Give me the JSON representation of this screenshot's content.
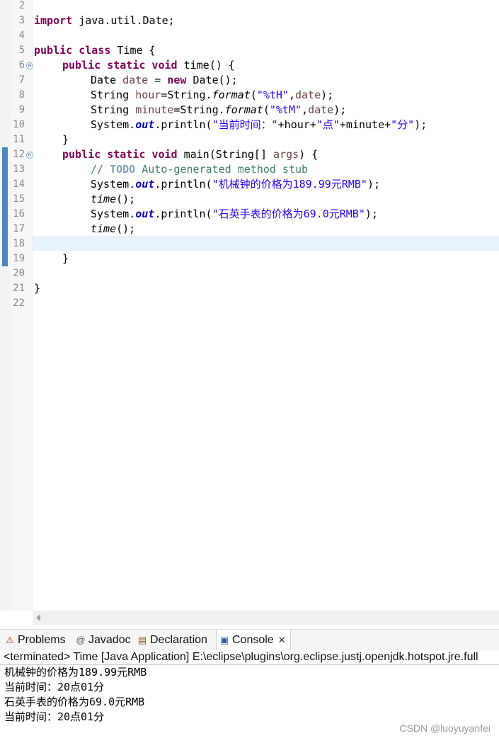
{
  "editor": {
    "line_numbers": [
      "2",
      "3",
      "4",
      "5",
      "6",
      "7",
      "8",
      "9",
      "10",
      "11",
      "12",
      "13",
      "14",
      "15",
      "16",
      "17",
      "18",
      "19",
      "20",
      "21",
      "22"
    ],
    "lines": {
      "l3": {
        "kw": "import",
        "rest": " java.util.Date;"
      },
      "l5": {
        "kw": "public class",
        "rest": " Time {"
      },
      "l6": {
        "kw": "public static void",
        "rest": " time() {"
      },
      "l7": {
        "a": "Date ",
        "var": "date",
        "b": " = ",
        "kw": "new",
        "c": " Date();"
      },
      "l8": {
        "a": "String ",
        "var": "hour",
        "b": "=String.",
        "fn": "format",
        "c": "(",
        "str": "\"%tH\"",
        "d": ",",
        "var2": "date",
        "e": ");"
      },
      "l9": {
        "a": "String ",
        "var": "minute",
        "b": "=String.",
        "fn": "format",
        "c": "(",
        "str": "\"%tM\"",
        "d": ",",
        "var2": "date",
        "e": ");"
      },
      "l10": {
        "a": "System.",
        "fld": "out",
        "b": ".println(",
        "s1": "\"当前时间：\"",
        "c": "+hour+",
        "s2": "\"点\"",
        "d": "+minute+",
        "s3": "\"分\"",
        "e": ");"
      },
      "l11": {
        "a": "}"
      },
      "l12": {
        "kw": "public static void",
        "rest": " main(String[] ",
        "var": "args",
        "rest2": ") {"
      },
      "l13": {
        "c1": "// ",
        "todo": "TODO",
        "c2": " Auto-generated method stub"
      },
      "l14": {
        "a": "System.",
        "fld": "out",
        "b": ".println(",
        "str": "\"机械钟的价格为189.99元RMB\"",
        "c": ");"
      },
      "l15": {
        "fn": "time",
        "a": "();"
      },
      "l16": {
        "a": "System.",
        "fld": "out",
        "b": ".println(",
        "str": "\"石英手表的价格为69.0元RMB\"",
        "c": ");"
      },
      "l17": {
        "fn": "time",
        "a": "();"
      },
      "l19": {
        "a": "}"
      },
      "l21": {
        "a": "}"
      }
    },
    "fold_markers": [
      "⊖",
      "⊖"
    ]
  },
  "views": {
    "tabs": [
      {
        "label": "Problems",
        "icon": "problems-icon"
      },
      {
        "label": "Javadoc",
        "icon": "javadoc-icon"
      },
      {
        "label": "Declaration",
        "icon": "declaration-icon"
      },
      {
        "label": "Console",
        "icon": "console-icon"
      }
    ],
    "close_glyph": "✕"
  },
  "console": {
    "header": "<terminated> Time [Java Application] E:\\eclipse\\plugins\\org.eclipse.justj.openjdk.hotspot.jre.full",
    "output": [
      "机械钟的价格为189.99元RMB",
      "当前时间：20点01分",
      "石英手表的价格为69.0元RMB",
      "当前时间：20点01分"
    ]
  },
  "watermark": "CSDN @luoyuyanfei"
}
